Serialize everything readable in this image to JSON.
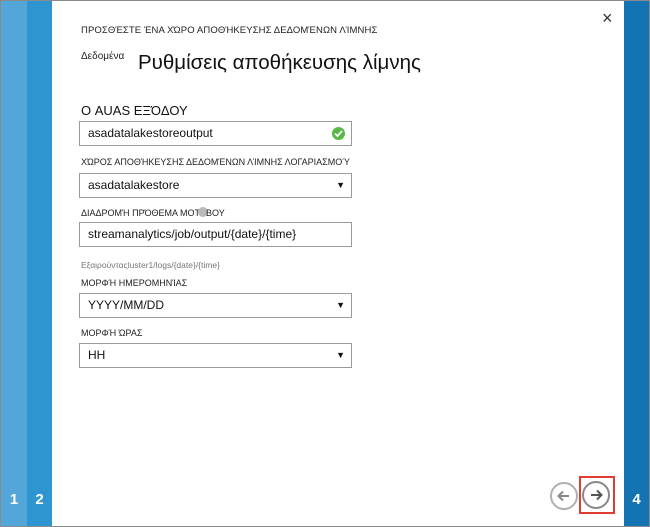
{
  "wizard": {
    "steps": {
      "s1": "1",
      "s2": "2",
      "s4": "4"
    },
    "supertitle": "ΠΡΟΣΘΈΣΤΕ ΈΝΑ ΧΏΡΟ ΑΠΟΘΉΚΕΥΣΗΣ ΔΕΔΟΜΈΝΩΝ ΛΊΜΝΗΣ",
    "title_prefix": "Δεδομένα",
    "title": "Ρυθμίσεις αποθήκευσης λίμνης",
    "close_icon": "×"
  },
  "form": {
    "output_alias_label": "Ο AUAS ΕΞΌΔΟΥ",
    "output_alias_value": "asadatalakestoreoutput",
    "account_label": "ΧΏΡΟΣ ΑΠΟΘΉΚΕΥΣΗΣ ΔΕΔΟΜΈΝΩΝ ΛΊΜΝΗΣ ΛΟΓΑΡΙΑΣΜΟΎ",
    "account_value": "asadatalakestore",
    "path_label_a": "ΔΙΑΔΡΟΜΉ ΠΡΌΘΕΜΑ  ΜΟΤ",
    "path_label_b": "ΒΟΥ",
    "path_value": "streamanalytics/job/output/{date}/{time}",
    "example_prefix": "Εξαιρούντας",
    "example_value": "luster1/logs/{date}/{time}",
    "date_label": "ΜΟΡΦΉ ΗΜΕΡΟΜΗΝΊΑΣ",
    "date_value": "YYYY/MM/DD",
    "time_label": "ΜΟΡΦΉ ΏΡΑΣ",
    "time_value": "HH",
    "caret": "▼"
  },
  "icons": {
    "prev": "arrow-left-icon",
    "next": "arrow-right-icon",
    "valid": "check-circle-icon",
    "info": "info-icon"
  },
  "colors": {
    "step1": "#52a6d8",
    "step2": "#2f95d0",
    "step4": "#1473b3",
    "valid": "#57b847",
    "highlight": "#e03c31"
  }
}
